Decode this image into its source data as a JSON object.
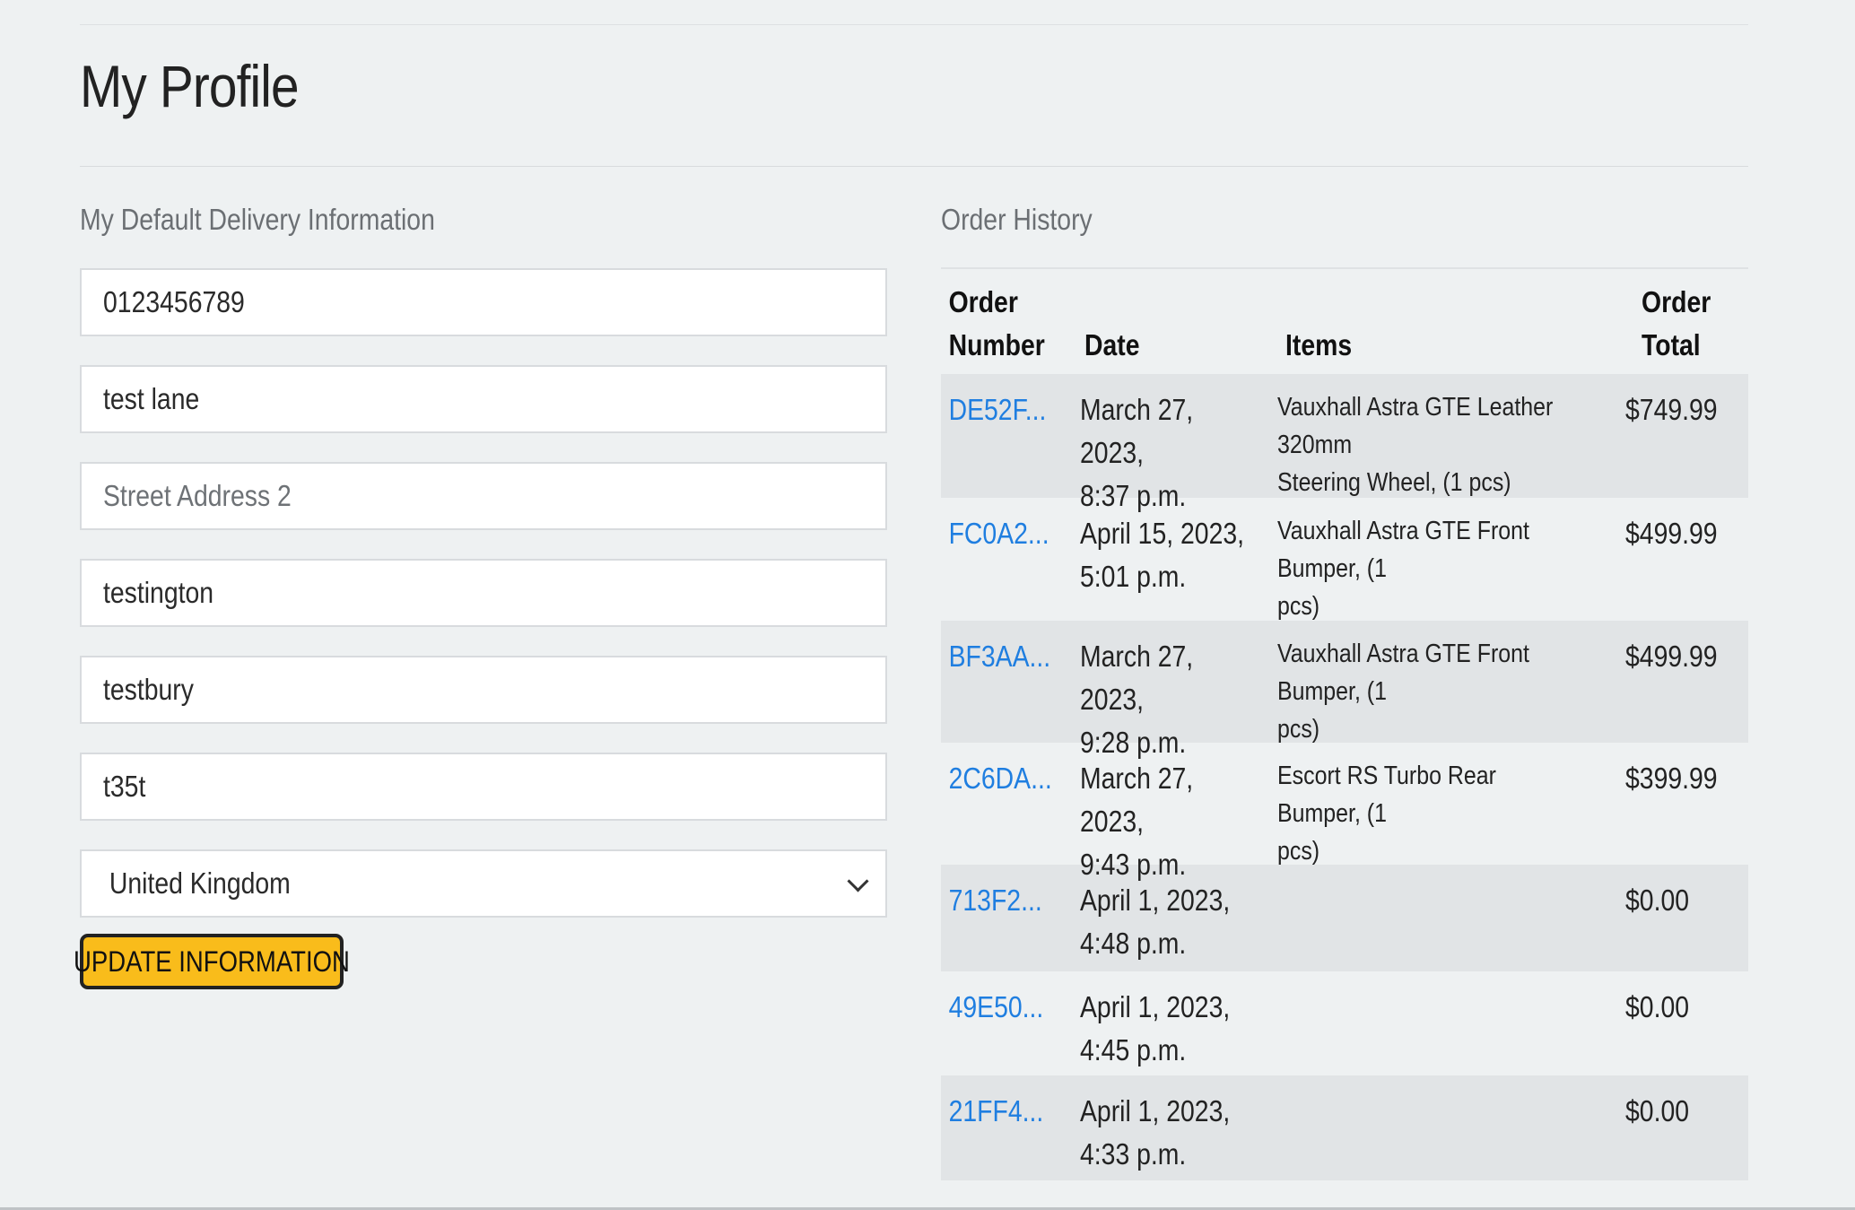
{
  "page": {
    "title": "My Profile"
  },
  "delivery": {
    "heading": "My Default Delivery Information",
    "phone": "0123456789",
    "street1": "test lane",
    "street2_placeholder": "Street Address 2",
    "town": "testington",
    "county": "testbury",
    "postcode": "t35t",
    "country": "United Kingdom",
    "button_label": "UPDATE INFORMATION"
  },
  "history": {
    "heading": "Order History",
    "columns": {
      "order_number_1": "Order",
      "order_number_2": "Number",
      "date": "Date",
      "items": "Items",
      "total_1": "Order",
      "total_2": "Total"
    },
    "orders": [
      {
        "number": "DE52F...",
        "date_1": "March 27, 2023,",
        "date_2": "8:37 p.m.",
        "items_1": "Vauxhall Astra GTE Leather 320mm",
        "items_2": "Steering Wheel, (1 pcs)",
        "total": "$749.99"
      },
      {
        "number": "FC0A2...",
        "date_1": "April 15, 2023,",
        "date_2": "5:01 p.m.",
        "items_1": "Vauxhall Astra GTE Front Bumper, (1",
        "items_2": "pcs)",
        "total": "$499.99"
      },
      {
        "number": "BF3AA...",
        "date_1": "March 27, 2023,",
        "date_2": "9:28 p.m.",
        "items_1": "Vauxhall Astra GTE Front Bumper, (1",
        "items_2": "pcs)",
        "total": "$499.99"
      },
      {
        "number": "2C6DA...",
        "date_1": "March 27, 2023,",
        "date_2": "9:43 p.m.",
        "items_1": "Escort RS Turbo Rear Bumper, (1",
        "items_2": "pcs)",
        "total": "$399.99"
      },
      {
        "number": "713F2...",
        "date_1": "April 1, 2023,",
        "date_2": "4:48 p.m.",
        "items_1": "",
        "items_2": "",
        "total": "$0.00"
      },
      {
        "number": "49E50...",
        "date_1": "April 1, 2023,",
        "date_2": "4:45 p.m.",
        "items_1": "",
        "items_2": "",
        "total": "$0.00"
      },
      {
        "number": "21FF4...",
        "date_1": "April 1, 2023,",
        "date_2": "4:33 p.m.",
        "items_1": "",
        "items_2": "",
        "total": "$0.00"
      }
    ]
  },
  "colors": {
    "background": "#eef1f2",
    "link": "#1f7ee0",
    "button": "#f9bc1b",
    "row_shade": "#e1e4e6"
  }
}
